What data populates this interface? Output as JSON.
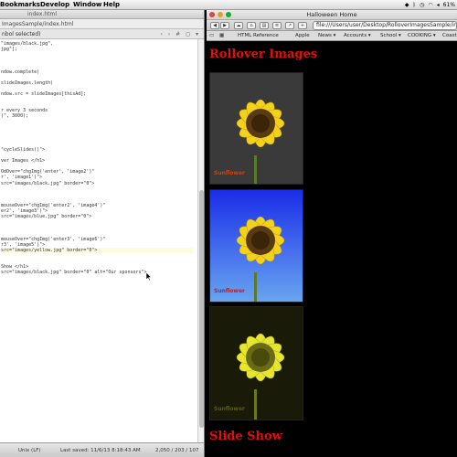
{
  "menubar": {
    "items": [
      "Bookmarks",
      "Develop",
      "Window",
      "Help"
    ],
    "battery": "61%"
  },
  "editor": {
    "title": "index.html",
    "path": "ImagesSample/index.html",
    "bar_text": "nbol selected)",
    "code_lines": [
      "\"images/black.jpg\",",
      "jpg\"];",
      "",
      "",
      "",
      "ndow.complete)",
      "",
      "slideImages.length)",
      "",
      "ndow.src = slideImages[thisAd];",
      "",
      "",
      "r every 3 seconds",
      ")\", 3000);",
      "",
      "",
      "",
      "",
      "",
      "\"cycleSlides()\">",
      "",
      "ver Images </h1>",
      "",
      "OdOver=\"chgImg('enter', 'image2')\"",
      "r', 'image1')\">",
      "src=\"images/black.jpg\" border=\"0\">",
      "",
      "",
      "",
      "mouseOver=\"chgImg('enter2', 'image4')\"",
      "er2', 'image3')\">",
      "src=\"images/blue.jpg\" border=\"0\">",
      "",
      "",
      "",
      "mouseOver=\"chgImg('enter3', 'image6')\"",
      "r3', 'image5')\">",
      "src=\"images/yellow.jpg\" border=\"0\">",
      "",
      "",
      "Show </h1>",
      "src=\"images/black.jpg\" border=\"0\" alt=\"Our sponsors\">"
    ],
    "status": {
      "line_endings": "Unix (LF)",
      "saved": "Last saved: 11/6/13 8:18:43 AM",
      "position": "2,050 / 203 / 107"
    }
  },
  "browser": {
    "title": "Halloween Home",
    "url": "file:///Users/user/Desktop/RolloverImagesSample/index.html",
    "bookmarks": [
      "HTML Reference",
      "Apple",
      "News ▾",
      "Accounts ▾",
      "School ▾",
      "COOKING ▾",
      "Coast"
    ],
    "page": {
      "heading": "Rollover Images",
      "images": [
        {
          "caption": "Sunflower",
          "bg": "#3a3a3a",
          "caption_color": "#c8421c"
        },
        {
          "caption": "Sunflower",
          "bg": "#2244ee",
          "caption_color": "#c81a1a"
        },
        {
          "caption": "Sunflower",
          "bg": "#1a1a08",
          "caption_color": "#5a5a1a"
        }
      ],
      "slide_heading": "Slide Show"
    }
  }
}
